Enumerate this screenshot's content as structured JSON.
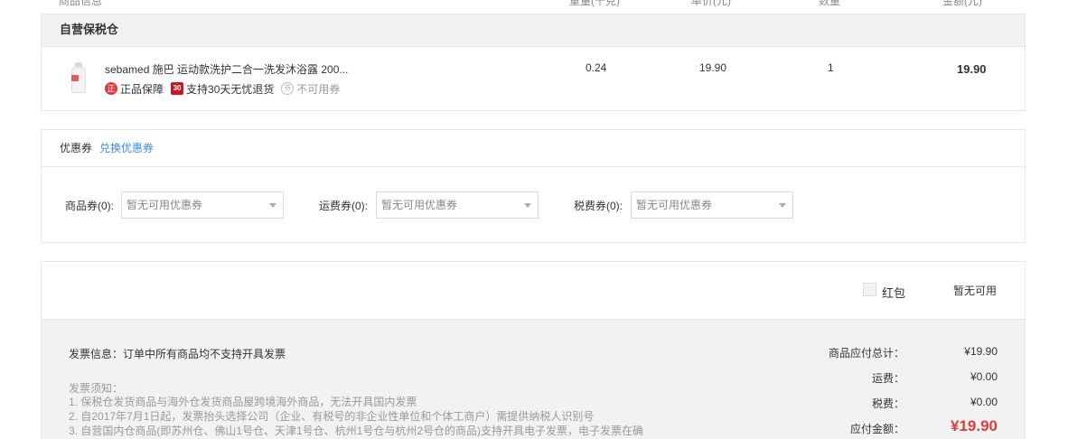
{
  "header": {
    "product_info": "商品信息",
    "weight": "重量(千克)",
    "unit_price": "单价(元)",
    "quantity": "数量",
    "amount": "金额(元)"
  },
  "store": {
    "name": "自营保税仓",
    "item": {
      "name": "sebamed 施巴 运动款洗护二合一洗发沐浴露 200...",
      "weight": "0.24",
      "unit_price": "19.90",
      "quantity": "1",
      "subtotal": "19.90",
      "badges": [
        {
          "icon": "正",
          "label": "正品保障"
        },
        {
          "icon": "30",
          "label": "支持30天无忧退货"
        },
        {
          "icon": "券",
          "label": "不可用券"
        }
      ]
    }
  },
  "coupon": {
    "title": "优惠券",
    "exchange_link": "兑换优惠券",
    "goods_label": "商品券(0):",
    "shipping_label": "运费券(0):",
    "tax_label": "税费券(0):",
    "placeholder": "暂无可用优惠券"
  },
  "hongbao": {
    "label": "红包",
    "status": "暂无可用"
  },
  "invoice": {
    "info": "发票信息：订单中所有商品均不支持开具发票",
    "notice_title": "发票须知：",
    "notices": [
      "1. 保税仓发货商品与海外仓发货商品屋跨境海外商品，无法开具国内发票",
      "2. 自2017年7月1日起，发票抬头选择公司（企业、有税号的非企业性单位和个体工商户）需提供纳税人识别号",
      "3. 自营国内仓商品(即苏州仓、佛山1号仓、天津1号仓、杭州1号仓与杭州2号仓的商品)支持开具电子发票，电子发票在确"
    ]
  },
  "totals": {
    "goods_label": "商品应付总计：",
    "goods_value": "¥19.90",
    "shipping_label": "运费：",
    "shipping_value": "¥0.00",
    "tax_label": "税费：",
    "tax_value": "¥0.00",
    "pay_label": "应付金额：",
    "pay_value": "¥19.90"
  },
  "colors": {
    "accent_red": "#e4393c",
    "link_blue": "#3a8ee6",
    "panel_gray": "#f2f2f2"
  }
}
